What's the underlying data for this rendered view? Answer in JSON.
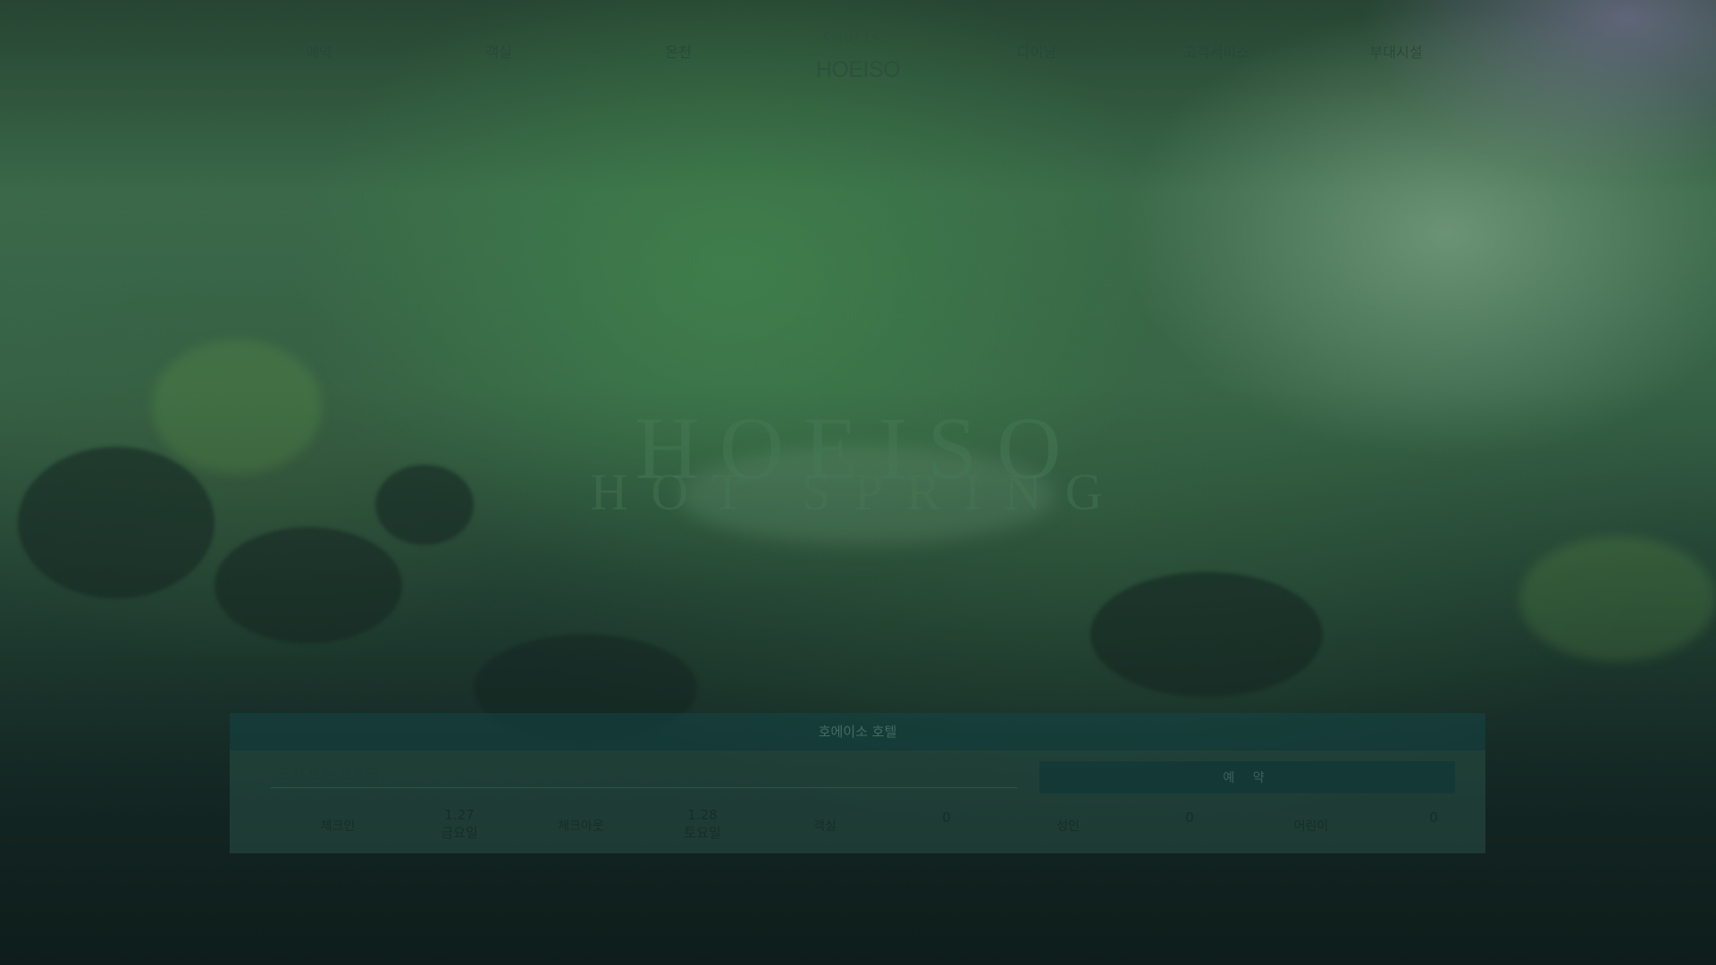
{
  "nav": {
    "left": [
      "예약",
      "객실",
      "온천"
    ],
    "right": [
      "다이닝",
      "고객서비스",
      "부대시설"
    ],
    "logo": {
      "line1": "KIJITEI",
      "line2": "HOEISO"
    }
  },
  "hero": {
    "title": "HOEISO",
    "subtitle": "HOT SPRING"
  },
  "booking": {
    "header": "호에이소 호텔",
    "placeholder": "도시 또는 호텔명",
    "reserve_label": "예 약",
    "checkin_label": "체크인",
    "checkin_date": "1.27",
    "checkin_day": "금요일",
    "checkout_label": "체크아웃",
    "checkout_date": "1.28",
    "checkout_day": "토요일",
    "rooms_label": "객실",
    "rooms_value": "0",
    "adults_label": "성인",
    "adults_value": "0",
    "children_label": "어린이",
    "children_value": "0"
  },
  "colors": {
    "accent": "#1a4a46",
    "background": "#2f5a40"
  }
}
